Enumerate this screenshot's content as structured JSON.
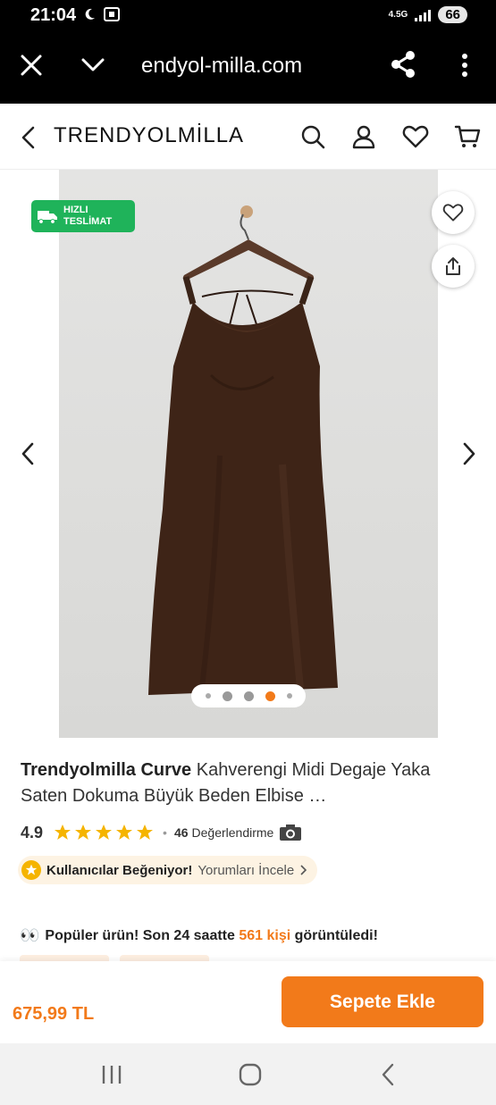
{
  "status_bar": {
    "time": "21:04",
    "network": "4.5G",
    "battery": "66"
  },
  "browser": {
    "url": "endyol-milla.com"
  },
  "header": {
    "brand": "TRENDYOLMİLLA"
  },
  "gallery": {
    "badge_line1": "HIZLI",
    "badge_line2": "TESLİMAT",
    "dots_total": 5,
    "active_dot": 4
  },
  "product": {
    "brand": "Trendyolmilla Curve",
    "name": " Kahverengi Midi Degaje Yaka Saten Dokuma Büyük Beden Elbise …",
    "rating": "4.9",
    "stars": 5,
    "review_count": "46",
    "review_label": "Değerlendirme",
    "liked_text": "Kullanıcılar Beğeniyor!",
    "liked_link": "Yorumları İncele",
    "popular_prefix": "Popüler ürün! Son 24 saatte ",
    "popular_count": "561 kişi",
    "popular_suffix": " görüntüledi!"
  },
  "cart": {
    "price": "675,99 TL",
    "add_label": "Sepete Ekle"
  },
  "colors": {
    "brand_orange": "#f27a1a",
    "badge_green": "#1fb35a",
    "star_yellow": "#f5b400"
  },
  "icons": [
    "close-icon",
    "chevron-down-icon",
    "share-icon",
    "more-icon",
    "back-icon",
    "search-icon",
    "user-icon",
    "heart-icon",
    "cart-icon",
    "truck-icon",
    "camera-icon",
    "star-icon"
  ]
}
